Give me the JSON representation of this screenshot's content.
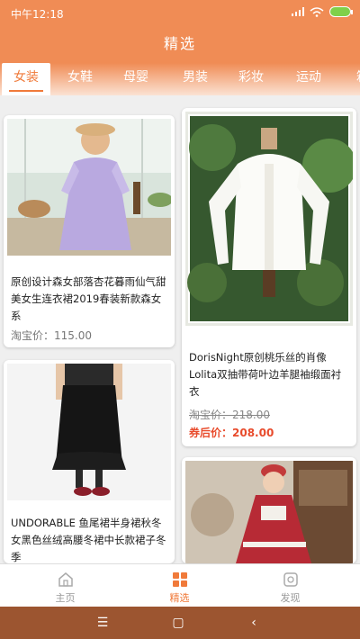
{
  "status_bar": {
    "time": "中午12:18",
    "battery_color": "#7fd04a"
  },
  "header": {
    "title": "精选"
  },
  "tabs": [
    {
      "label": "女装",
      "active": true
    },
    {
      "label": "女鞋",
      "active": false
    },
    {
      "label": "母婴",
      "active": false
    },
    {
      "label": "男装",
      "active": false
    },
    {
      "label": "彩妆",
      "active": false
    },
    {
      "label": "运动",
      "active": false
    },
    {
      "label": "箱",
      "active": false
    }
  ],
  "products": [
    {
      "desc": "原创设计森女部落杏花暮雨仙气甜美女生连衣裙2019春装新款森女系",
      "price_label": "淘宝价：115.00"
    },
    {
      "desc": "DorisNight原创桃乐丝的肖像Lolita双抽带荷叶边羊腿袖缎面衬衣",
      "old_price": "淘宝价：218.00",
      "coupon_price": "券后价：208.00"
    },
    {
      "desc": "UNDORABLE 鱼尾裙半身裙秋冬女黑色丝绒高腰冬裙中长款裙子冬季"
    },
    {
      "desc": ""
    }
  ],
  "bottom_nav": [
    {
      "label": "主页",
      "icon": "home-icon",
      "active": false
    },
    {
      "label": "精选",
      "icon": "grid-icon",
      "active": true
    },
    {
      "label": "发现",
      "icon": "discover-icon",
      "active": false
    }
  ],
  "colors": {
    "accent": "#f07a3a",
    "header_bg": "#f08c55",
    "price_red": "#e84b2c",
    "system_nav_bg": "#9c5530"
  }
}
